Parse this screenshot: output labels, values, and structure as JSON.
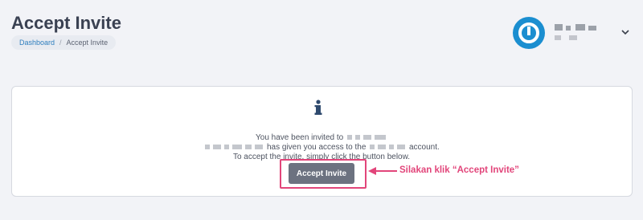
{
  "header": {
    "title": "Accept Invite",
    "breadcrumb": {
      "home": "Dashboard",
      "separator": "/",
      "current": "Accept Invite"
    }
  },
  "user_menu": {
    "avatar_icon": "power-icon",
    "name": "",
    "dropdown_icon": "chevron-down-icon"
  },
  "invite": {
    "info_icon": "info-icon",
    "line1_start": "You have been invited to",
    "line2_middle": "has given you access to the",
    "line2_end": "account.",
    "line3": "To accept the invite, simply click the button below.",
    "accept_label": "Accept Invite"
  },
  "annotation": {
    "label": "Silakan klik “Accept Invite”",
    "color": "#e2457a"
  },
  "colors": {
    "avatar": "#1b8ed0",
    "button": "#6c7280",
    "link": "#2f7fbe"
  }
}
